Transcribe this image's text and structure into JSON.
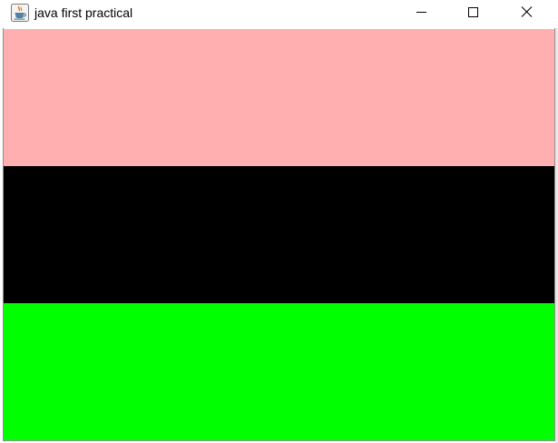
{
  "window": {
    "title": "java first practical",
    "app_icon": "java-coffee-cup-icon",
    "controls": {
      "minimize_icon": "minimize-icon",
      "maximize_icon": "maximize-icon",
      "close_icon": "close-icon"
    }
  },
  "panels": [
    {
      "name": "top-panel",
      "color": "#ffafaf"
    },
    {
      "name": "middle-panel",
      "color": "#000000"
    },
    {
      "name": "bottom-panel",
      "color": "#00ff00"
    }
  ]
}
